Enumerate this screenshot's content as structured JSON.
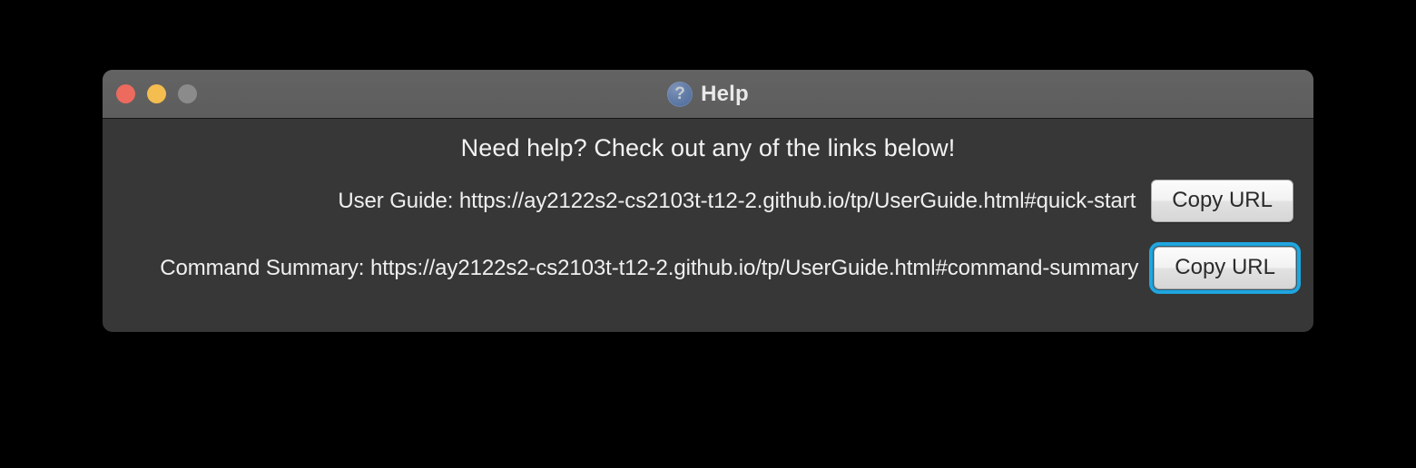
{
  "window": {
    "title": "Help",
    "help_icon": "question-mark-circle-icon",
    "traffic_lights": {
      "close": "close-button",
      "minimize": "minimize-button",
      "zoom": "zoom-button"
    },
    "colors": {
      "titlebar": "#5f5f5f",
      "body": "#373737",
      "desktop": "#000000",
      "close": "#ec6a5e",
      "minimize": "#f4bd4f",
      "zoom": "#8b8b8b",
      "focus_ring": "#1fa6e0",
      "text": "#f0f0f0",
      "button_text": "#2b2b2b"
    }
  },
  "content": {
    "heading": "Need help? Check out any of the links below!",
    "links": [
      {
        "label": "User Guide: https://ay2122s2-cs2103t-t12-2.github.io/tp/UserGuide.html#quick-start",
        "button_label": "Copy URL",
        "focused": false
      },
      {
        "label": "Command Summary: https://ay2122s2-cs2103t-t12-2.github.io/tp/UserGuide.html#command-summary",
        "button_label": "Copy URL",
        "focused": true
      }
    ]
  }
}
